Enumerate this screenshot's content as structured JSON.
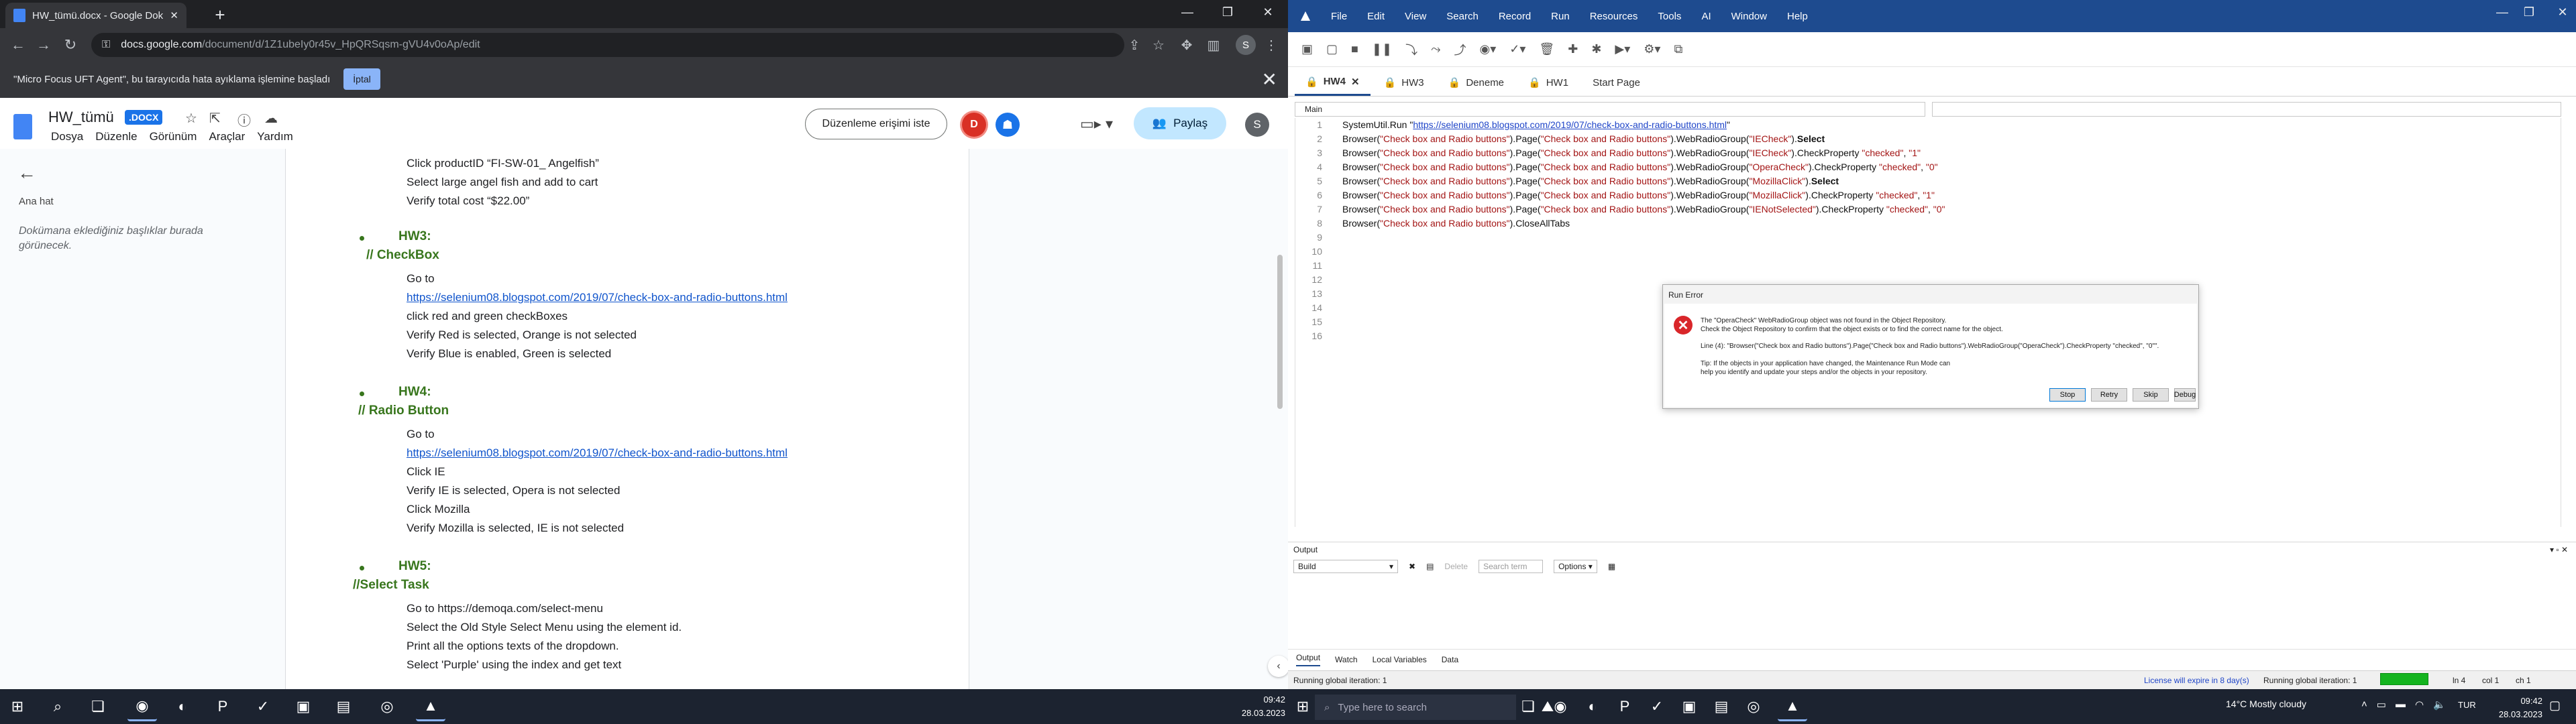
{
  "chrome": {
    "tab_title": "HW_tümü.docx - Google Dokümanlar",
    "url_host": "docs.google.com",
    "url_path": "/document/d/1Z1ubeIy0r45v_HpQRSqsm-gVU4v0oAp/edit",
    "avatar": "S",
    "infobar_text": "\"Micro Focus UFT Agent\", bu tarayıcıda hata ayıklama işlemine başladı",
    "infobar_cancel": "İptal"
  },
  "docs": {
    "title": "HW_tümü",
    "badge": ".DOCX",
    "menu": [
      "Dosya",
      "Düzenle",
      "Görünüm",
      "Araçlar",
      "Yardım"
    ],
    "request_access": "Düzenleme erişimi iste",
    "avatar_d": "D",
    "share": "Paylaş",
    "avatar_s": "S",
    "outline_label": "Ana hat",
    "outline_hint": "Dokümana eklediğiniz başlıklar burada görünecek.",
    "lines": {
      "l1": "Click productID “FI-SW-01_ Angelfish”",
      "l2": "Select large angel fish and add to cart",
      "l3": "Verify total cost “$22.00”",
      "hw3": "HW3:",
      "hw3_c": "// CheckBox",
      "l4": "Go to",
      "link1": "https://selenium08.blogspot.com/2019/07/check-box-and-radio-buttons.html",
      "l5": "click red and green checkBoxes",
      "l6": "Verify Red is selected, Orange is not selected",
      "l7": "Verify Blue is enabled, Green is selected",
      "hw4": "HW4:",
      "hw4_c": "// Radio Button",
      "l8": "Go to",
      "link2": "https://selenium08.blogspot.com/2019/07/check-box-and-radio-buttons.html",
      "l9": "Click IE",
      "l10": "Verify IE is selected, Opera is not selected",
      "l11": "Click Mozilla",
      "l12": "Verify Mozilla is selected, IE is not selected",
      "hw5": "HW5:",
      "hw5_c": "//Select Task",
      "l13": "Go to https://demoqa.com/select-menu",
      "l14": "Select the Old Style Select Menu using the element id.",
      "l15": "Print all the options texts of the dropdown.",
      "l16": "Select 'Purple' using the index and get text"
    }
  },
  "uft": {
    "menu": [
      "File",
      "Edit",
      "View",
      "Search",
      "Record",
      "Run",
      "Resources",
      "Tools",
      "AI",
      "Window",
      "Help"
    ],
    "tabs": [
      "HW4",
      "HW3",
      "Deneme",
      "HW1",
      "Start Page"
    ],
    "selector": "Main",
    "code": {
      "c1a": "SystemUtil.Run \"",
      "c1u": "https://selenium08.blogspot.com/2019/07/check-box-and-radio-buttons.html",
      "c1b": "\"",
      "c2a": "Browser(",
      "c2s1": "\"Check box and Radio buttons\"",
      "c2b": ").Page(",
      "c2s2": "\"Check box and Radio buttons\"",
      "c2c": ").WebRadioGroup(",
      "c2s3": "\"IECheck\"",
      "c2d": ").",
      "c2k": "Select",
      "c3s3": "\"IECheck\"",
      "c3d": ").CheckProperty ",
      "c3s4": "\"checked\"",
      "c3e": ", ",
      "c3s5": "\"1\"",
      "c4s3": "\"OperaCheck\"",
      "c4s5": "\"0\"",
      "c5s3": "\"MozillaClick\"",
      "c6s3": "\"MozillaClick\"",
      "c6s5": "\"1\"",
      "c7s3": "\"IENotSelected\"",
      "c7s5": "\"0\"",
      "c8d": ").CloseAllTabs"
    },
    "line_numbers": [
      "1",
      "2",
      "3",
      "4",
      "5",
      "6",
      "7",
      "8",
      "9",
      "10",
      "11",
      "12",
      "13",
      "14",
      "15",
      "16"
    ],
    "dialog": {
      "title": "Run Error",
      "m1": "The \"OperaCheck\" WebRadioGroup object was not found in the Object Repository.",
      "m2": "Check the Object Repository to confirm that the object exists or to find the correct name for the object.",
      "m3": "Line (4): \"Browser(\"Check box and Radio buttons\").Page(\"Check box and Radio buttons\").WebRadioGroup(\"OperaCheck\").CheckProperty \"checked\", \"0\"\".",
      "m4": "Tip: If the objects in your application have changed, the Maintenance Run Mode can",
      "m5": "help you identify and update your steps and/or the objects in your repository.",
      "stop": "Stop",
      "retry": "Retry",
      "skip": "Skip",
      "debug": "Debug"
    },
    "output": {
      "header": "Output",
      "build": "Build",
      "search": "Search term",
      "options": "Options",
      "clear": "Delete"
    },
    "bottom_tabs": [
      "Output",
      "Watch",
      "Local Variables",
      "Data"
    ],
    "status": {
      "left": "Running global iteration: 1",
      "license": "License will expire in 8 day(s)",
      "right": "Running global iteration: 1",
      "ln": "ln 4",
      "col": "col 1",
      "chr": "ch 1"
    }
  },
  "taskbar": {
    "time1": "09:42",
    "date1": "28.03.2023",
    "search": "Type here to search",
    "weather": "14°C  Mostly cloudy",
    "lang": "TUR",
    "time2": "09:42",
    "date2": "28.03.2023"
  }
}
